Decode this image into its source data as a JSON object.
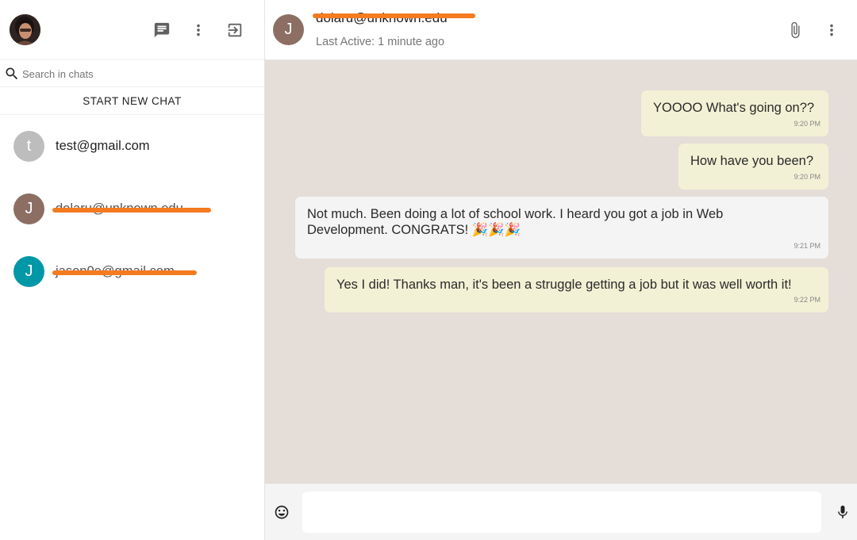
{
  "sidebar": {
    "search_placeholder": "Search in chats",
    "new_chat_label": "START NEW CHAT",
    "chats": [
      {
        "initial": "t",
        "name": "test@gmail.com",
        "avatar_color": "#bdbdbd",
        "redacted": false
      },
      {
        "initial": "J",
        "name": "dolaru@unknown.edu",
        "avatar_color": "#8d6e63",
        "redacted": true
      },
      {
        "initial": "J",
        "name": "jason0o@gmail.com",
        "avatar_color": "#0097a7",
        "redacted": true
      }
    ]
  },
  "conversation": {
    "contact_initial": "J",
    "contact_name": "dolaru@unknown.edu",
    "last_active": "Last Active: 1 minute ago",
    "messages": [
      {
        "direction": "out",
        "text": "YOOOO What's going on??",
        "time": "9:20 PM"
      },
      {
        "direction": "out",
        "text": "How have you been?",
        "time": "9:20 PM"
      },
      {
        "direction": "in",
        "text": "Not much. Been doing a lot of school work. I heard you got a job in Web Development. CONGRATS! 🎉🎉🎉",
        "time": "9:21 PM"
      },
      {
        "direction": "out",
        "text": "Yes I did! Thanks man, it's been a struggle getting a job but it was well worth it!",
        "time": "9:22 PM"
      }
    ]
  },
  "colors": {
    "chat_background": "#e5ddd8",
    "outgoing_bubble": "#f3f1d5",
    "incoming_bubble": "#f4f4f4",
    "redaction": "#f47b20"
  },
  "icons": {
    "new_chat": "chat-icon",
    "menu": "more-vert-icon",
    "logout": "logout-icon",
    "search": "search-icon",
    "attach": "paperclip-icon",
    "emoji": "emoji-icon",
    "mic": "mic-icon"
  }
}
